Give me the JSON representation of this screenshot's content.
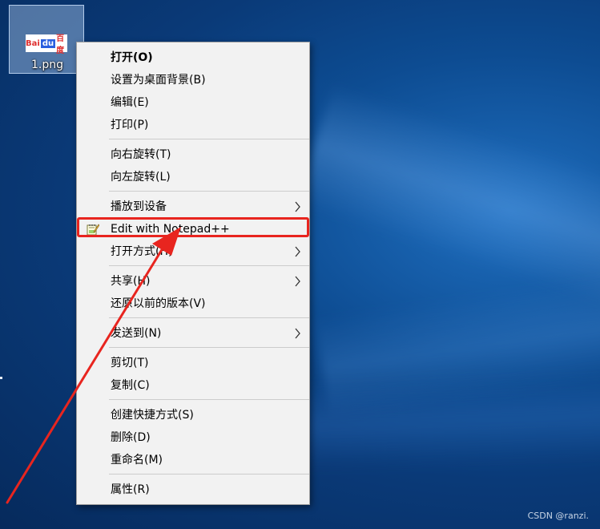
{
  "desktop": {
    "icon": {
      "label": "1.png",
      "thumbnail": {
        "text_left": "Bai",
        "text_badge": "du",
        "text_right": "百度"
      }
    }
  },
  "context_menu": {
    "items": [
      {
        "label": "打开(O)",
        "bold": true
      },
      {
        "label": "设置为桌面背景(B)"
      },
      {
        "label": "编辑(E)"
      },
      {
        "label": "打印(P)"
      },
      {
        "label": "向右旋转(T)"
      },
      {
        "label": "向左旋转(L)"
      },
      {
        "label": "播放到设备",
        "submenu": true
      },
      {
        "label": "Edit with Notepad++",
        "icon": "notepad-plus-plus-icon",
        "highlighted": true
      },
      {
        "label": "打开方式(H)",
        "submenu": true
      },
      {
        "label": "共享(H)",
        "submenu": true
      },
      {
        "label": "还原以前的版本(V)"
      },
      {
        "label": "发送到(N)",
        "submenu": true
      },
      {
        "label": "剪切(T)"
      },
      {
        "label": "复制(C)"
      },
      {
        "label": "创建快捷方式(S)"
      },
      {
        "label": "删除(D)"
      },
      {
        "label": "重命名(M)"
      },
      {
        "label": "属性(R)"
      }
    ]
  },
  "annotation": {
    "highlight_color": "#e8251f",
    "arrow_color": "#e8251f"
  },
  "watermark": "CSDN @ranzi."
}
